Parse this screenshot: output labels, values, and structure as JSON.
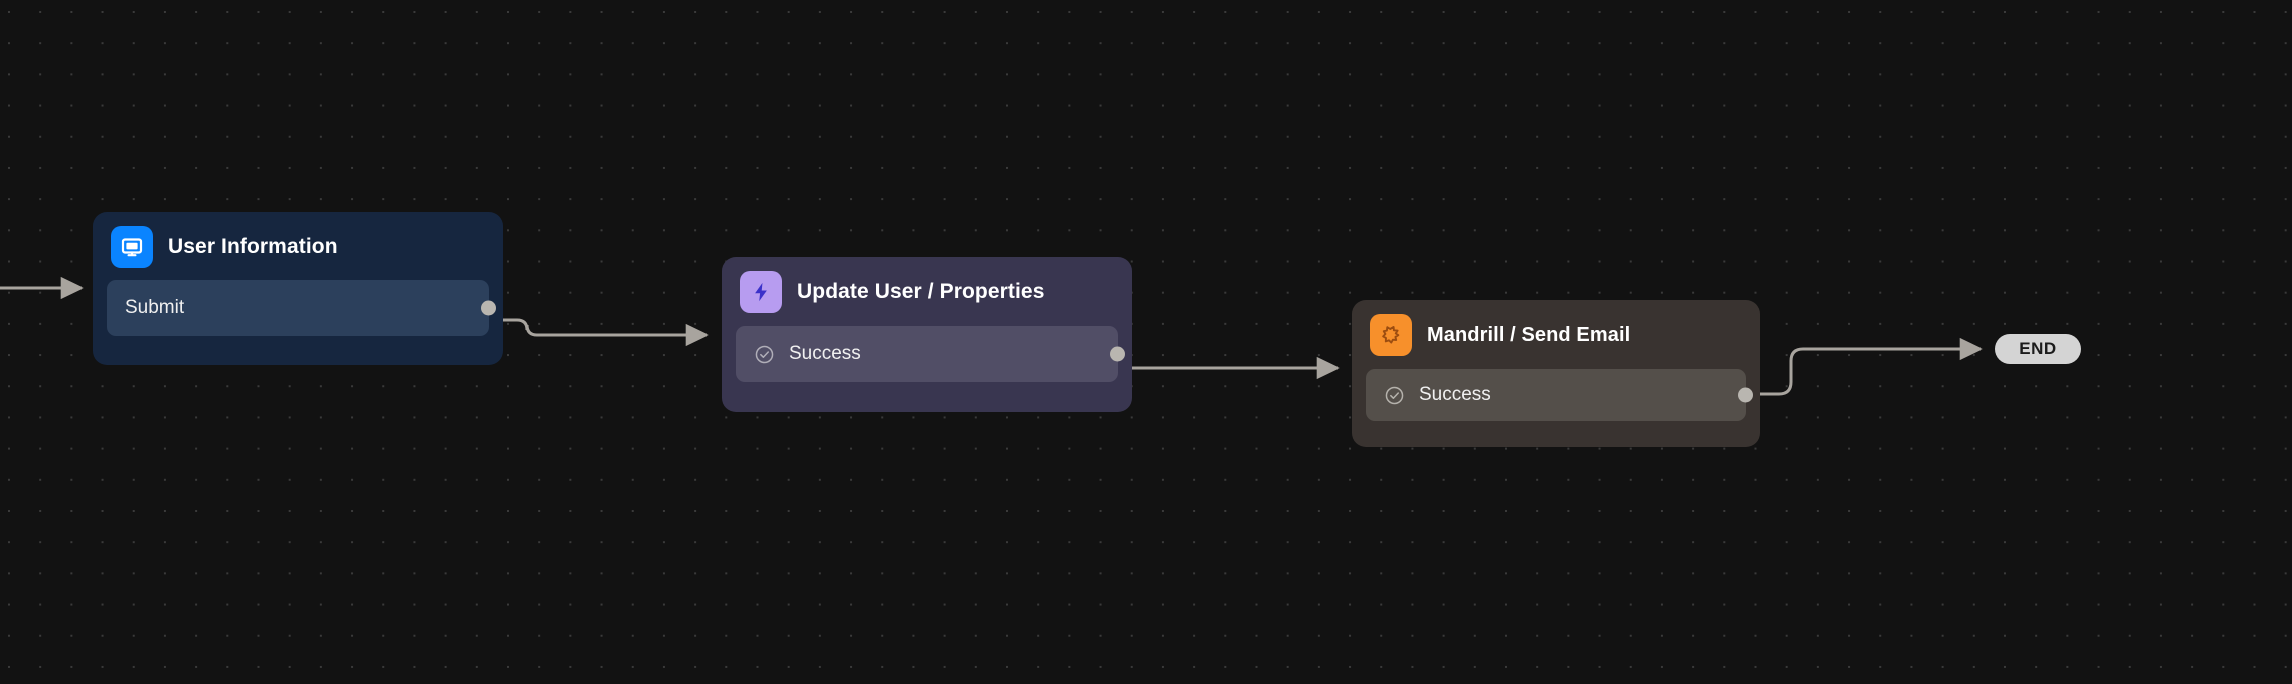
{
  "canvas": {
    "background_color": "#121212",
    "grid_dot_color": "#3a3a3a"
  },
  "nodes": [
    {
      "id": "user-information",
      "title": "User Information",
      "icon": "monitor-icon",
      "icon_bg": "#0a84ff",
      "node_bg": "#16263f",
      "rows": [
        {
          "label": "Submit",
          "icon": null,
          "has_port": true
        }
      ]
    },
    {
      "id": "update-user-properties",
      "title": "Update User / Properties",
      "icon": "lightning-bolt-icon",
      "icon_bg": "#b79cf0",
      "node_bg": "#393650",
      "rows": [
        {
          "label": "Success",
          "icon": "check-circle-icon",
          "has_port": true
        }
      ]
    },
    {
      "id": "mandrill-send-email",
      "title": "Mandrill / Send Email",
      "icon": "mandrill-icon",
      "icon_bg": "#f7902b",
      "node_bg": "#393330",
      "rows": [
        {
          "label": "Success",
          "icon": "check-circle-icon",
          "has_port": true
        }
      ]
    }
  ],
  "terminal": {
    "label": "END",
    "background_color": "#d4d4d4",
    "text_color": "#1b1b1b"
  },
  "edges": {
    "color": "#a8a49e",
    "connections": [
      {
        "from": "canvas-left",
        "to": "user-information"
      },
      {
        "from": "user-information.Submit",
        "to": "update-user-properties"
      },
      {
        "from": "update-user-properties.Success",
        "to": "mandrill-send-email"
      },
      {
        "from": "mandrill-send-email.Success",
        "to": "END"
      }
    ]
  }
}
